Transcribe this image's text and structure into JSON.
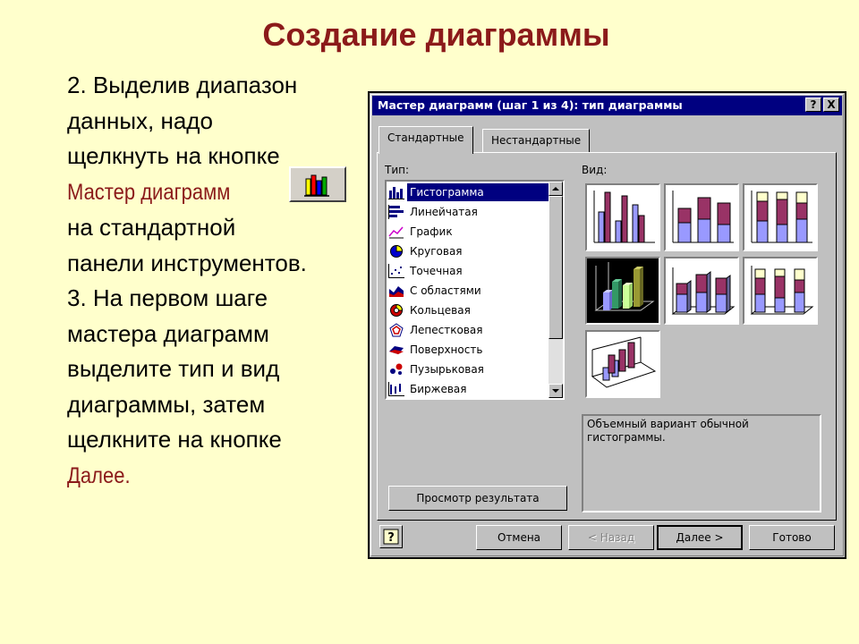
{
  "slide": {
    "title": "Создание диаграммы",
    "lines": [
      "2. Выделив диапазон",
      "данных, надо",
      "щелкнуть на кнопке",
      "Мастер диаграмм",
      "на стандартной",
      "панели инструментов.",
      "3. На первом  шаге",
      "мастера диаграмм",
      "выделите тип и вид",
      "диаграммы, затем",
      "щелкните на кнопке",
      "Далее."
    ]
  },
  "colors": {
    "accent": "#8b1a1a",
    "title_bar": "#000080",
    "background": "#ffffcc",
    "bar_purple": "#993366",
    "bar_blue": "#9999ff",
    "bar_yellow": "#ffffcc"
  },
  "dialog": {
    "title": "Мастер диаграмм (шаг 1 из 4): тип диаграммы",
    "help_btn": "?",
    "close_btn": "X",
    "tabs": [
      "Стандартные",
      "Нестандартные"
    ],
    "type_label": "Тип:",
    "view_label": "Вид:",
    "chart_types": [
      {
        "label": "Гистограмма",
        "icon": "column-chart-icon",
        "selected": true
      },
      {
        "label": "Линейчатая",
        "icon": "bar-chart-icon"
      },
      {
        "label": "График",
        "icon": "line-chart-icon"
      },
      {
        "label": "Круговая",
        "icon": "pie-chart-icon"
      },
      {
        "label": "Точечная",
        "icon": "scatter-chart-icon"
      },
      {
        "label": "С областями",
        "icon": "area-chart-icon"
      },
      {
        "label": "Кольцевая",
        "icon": "doughnut-chart-icon"
      },
      {
        "label": "Лепестковая",
        "icon": "radar-chart-icon"
      },
      {
        "label": "Поверхность",
        "icon": "surface-chart-icon"
      },
      {
        "label": "Пузырьковая",
        "icon": "bubble-chart-icon"
      },
      {
        "label": "Биржевая",
        "icon": "stock-chart-icon"
      }
    ],
    "subtypes_selected_index": 3,
    "description": "Объемный вариант обычной гистограммы.",
    "preview_button": "Просмотр результата",
    "buttons": {
      "cancel": "Отмена",
      "back": "< Назад",
      "next": "Далее >",
      "finish": "Готово"
    }
  }
}
